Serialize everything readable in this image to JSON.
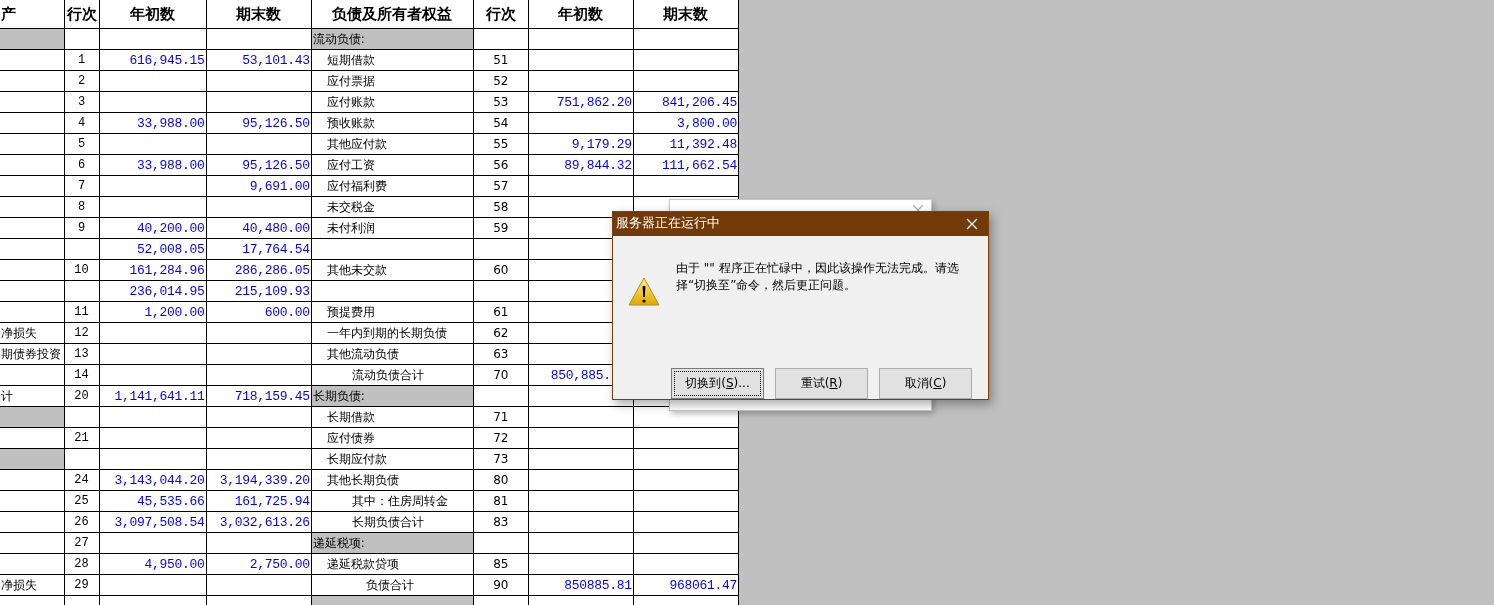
{
  "sheet": {
    "columns": [
      "产",
      "行次",
      "年初数",
      "期末数",
      "负债及所有者权益",
      "行次",
      "年初数",
      "期末数"
    ],
    "rows": [
      {
        "asset": {
          "kind": "section"
        },
        "liability": {
          "text": "流动负债:",
          "kind": "section"
        }
      },
      {
        "line": "1",
        "begin": "616,945.15",
        "end": "53,101.43",
        "liability": {
          "text": "短期借款",
          "kind": "item"
        },
        "line_2": "51"
      },
      {
        "line": "2",
        "liability": {
          "text": "应付票据",
          "kind": "item"
        },
        "line_2": "52"
      },
      {
        "line": "3",
        "liability": {
          "text": "应付账款",
          "kind": "item"
        },
        "line_2": "53",
        "begin_2": "751,862.20",
        "end_2": "841,206.45"
      },
      {
        "line": "4",
        "begin": "33,988.00",
        "end": "95,126.50",
        "liability": {
          "text": "预收账款",
          "kind": "item"
        },
        "line_2": "54",
        "end_2": "3,800.00"
      },
      {
        "line": "5",
        "liability": {
          "text": "其他应付款",
          "kind": "item"
        },
        "line_2": "55",
        "begin_2": "9,179.29",
        "end_2": "11,392.48"
      },
      {
        "line": "6",
        "begin": "33,988.00",
        "end": "95,126.50",
        "liability": {
          "text": "应付工资",
          "kind": "item"
        },
        "line_2": "56",
        "begin_2": "89,844.32",
        "end_2": "111,662.54"
      },
      {
        "line": "7",
        "end": "9,691.00",
        "liability": {
          "text": "应付福利费",
          "kind": "item"
        },
        "line_2": "57"
      },
      {
        "line": "8",
        "liability": {
          "text": "未交税金",
          "kind": "item"
        },
        "line_2": "58"
      },
      {
        "line": "9",
        "begin": "40,200.00",
        "end": "40,480.00",
        "liability": {
          "text": "未付利润",
          "kind": "item"
        },
        "line_2": "59"
      },
      {
        "begin": "52,008.05",
        "end": "17,764.54"
      },
      {
        "line": "10",
        "begin": "161,284.96",
        "end": "286,286.05",
        "liability": {
          "text": "其他未交款",
          "kind": "item"
        },
        "line_2": "60"
      },
      {
        "begin": "236,014.95",
        "end": "215,109.93"
      },
      {
        "line": "11",
        "begin": "1,200.00",
        "end": "600.00",
        "liability": {
          "text": "预提费用",
          "kind": "item"
        },
        "line_2": "61"
      },
      {
        "asset": {
          "text": "净损失",
          "kind": "item"
        },
        "line": "12",
        "liability": {
          "text": "一年内到期的长期负债",
          "kind": "item"
        },
        "line_2": "62"
      },
      {
        "asset": {
          "text": "期债券投资",
          "kind": "item"
        },
        "line": "13",
        "liability": {
          "text": "其他流动负债",
          "kind": "item"
        },
        "line_2": "63"
      },
      {
        "line": "14",
        "liability": {
          "text": "流动负债合计",
          "kind": "subtotal"
        },
        "line_2": "70",
        "begin_2": "850,885.",
        "begin_2_covered": true
      },
      {
        "asset": {
          "text": "计",
          "kind": "item"
        },
        "line": "20",
        "begin": "1,141,641.11",
        "end": "718,159.45",
        "liability": {
          "text": "长期负债:",
          "kind": "section"
        }
      },
      {
        "asset": {
          "kind": "section"
        },
        "liability": {
          "text": "长期借款",
          "kind": "item"
        },
        "line_2": "71"
      },
      {
        "line": "21",
        "liability": {
          "text": "应付债券",
          "kind": "item"
        },
        "line_2": "72"
      },
      {
        "asset": {
          "kind": "section"
        },
        "liability": {
          "text": "长期应付款",
          "kind": "item"
        },
        "line_2": "73"
      },
      {
        "line": "24",
        "begin": "3,143,044.20",
        "end": "3,194,339.20",
        "liability": {
          "text": "其他长期负债",
          "kind": "item"
        },
        "line_2": "80"
      },
      {
        "line": "25",
        "begin": "45,535.66",
        "end": "161,725.94",
        "liability": {
          "text": "其中：住房周转金",
          "kind": "subtotal"
        },
        "line_2": "81"
      },
      {
        "line": "26",
        "begin": "3,097,508.54",
        "end": "3,032,613.26",
        "liability": {
          "text": "长期负债合计",
          "kind": "subtotal"
        },
        "line_2": "83"
      },
      {
        "line": "27",
        "liability": {
          "text": "递延税项:",
          "kind": "section"
        }
      },
      {
        "line": "28",
        "begin": "4,950.00",
        "end": "2,750.00",
        "liability": {
          "text": "递延税款贷项",
          "kind": "item"
        },
        "line_2": "85"
      },
      {
        "asset": {
          "text": "净损失",
          "kind": "item"
        },
        "line": "29",
        "liability": {
          "text": "负债合计",
          "kind": "total"
        },
        "line_2": "90",
        "begin_2": "850885.81",
        "end_2": "968061.47"
      },
      {
        "liability": {
          "kind": "section"
        }
      }
    ]
  },
  "dialog": {
    "title": "服务器正在运行中",
    "message": "由于 \"\" 程序正在忙碌中，因此该操作无法完成。请选择“切换至”命令，然后更正问题。",
    "buttons": [
      {
        "before": "切换到(",
        "mnemonic": "S",
        "after": ")...",
        "focused": true
      },
      {
        "before": "重试(",
        "mnemonic": "R",
        "after": ")",
        "focused": false
      },
      {
        "before": "取消(",
        "mnemonic": "C",
        "after": ")",
        "focused": false
      }
    ]
  }
}
